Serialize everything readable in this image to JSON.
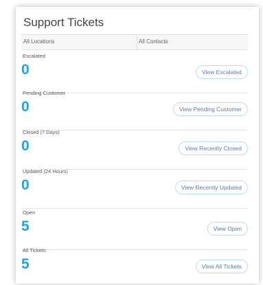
{
  "widget": {
    "title": "Support Tickets"
  },
  "filters": {
    "locations": "All Locations",
    "contacts": "All Contacts"
  },
  "sections": [
    {
      "label": "Escalated",
      "count": "0",
      "button": "View Escalated"
    },
    {
      "label": "Pending Customer",
      "count": "0",
      "button": "View Pending Customer"
    },
    {
      "label": "Closed (7 Days)",
      "count": "0",
      "button": "View Recently Closed"
    },
    {
      "label": "Updated (24 Hours)",
      "count": "0",
      "button": "View Recently Updated"
    },
    {
      "label": "Open",
      "count": "5",
      "button": "View Open"
    },
    {
      "label": "All Tickets",
      "count": "5",
      "button": "View All Tickets"
    }
  ],
  "colors": {
    "count": "#1fa3dc",
    "button_text": "#5a7da0",
    "button_border": "#b9dcec"
  }
}
